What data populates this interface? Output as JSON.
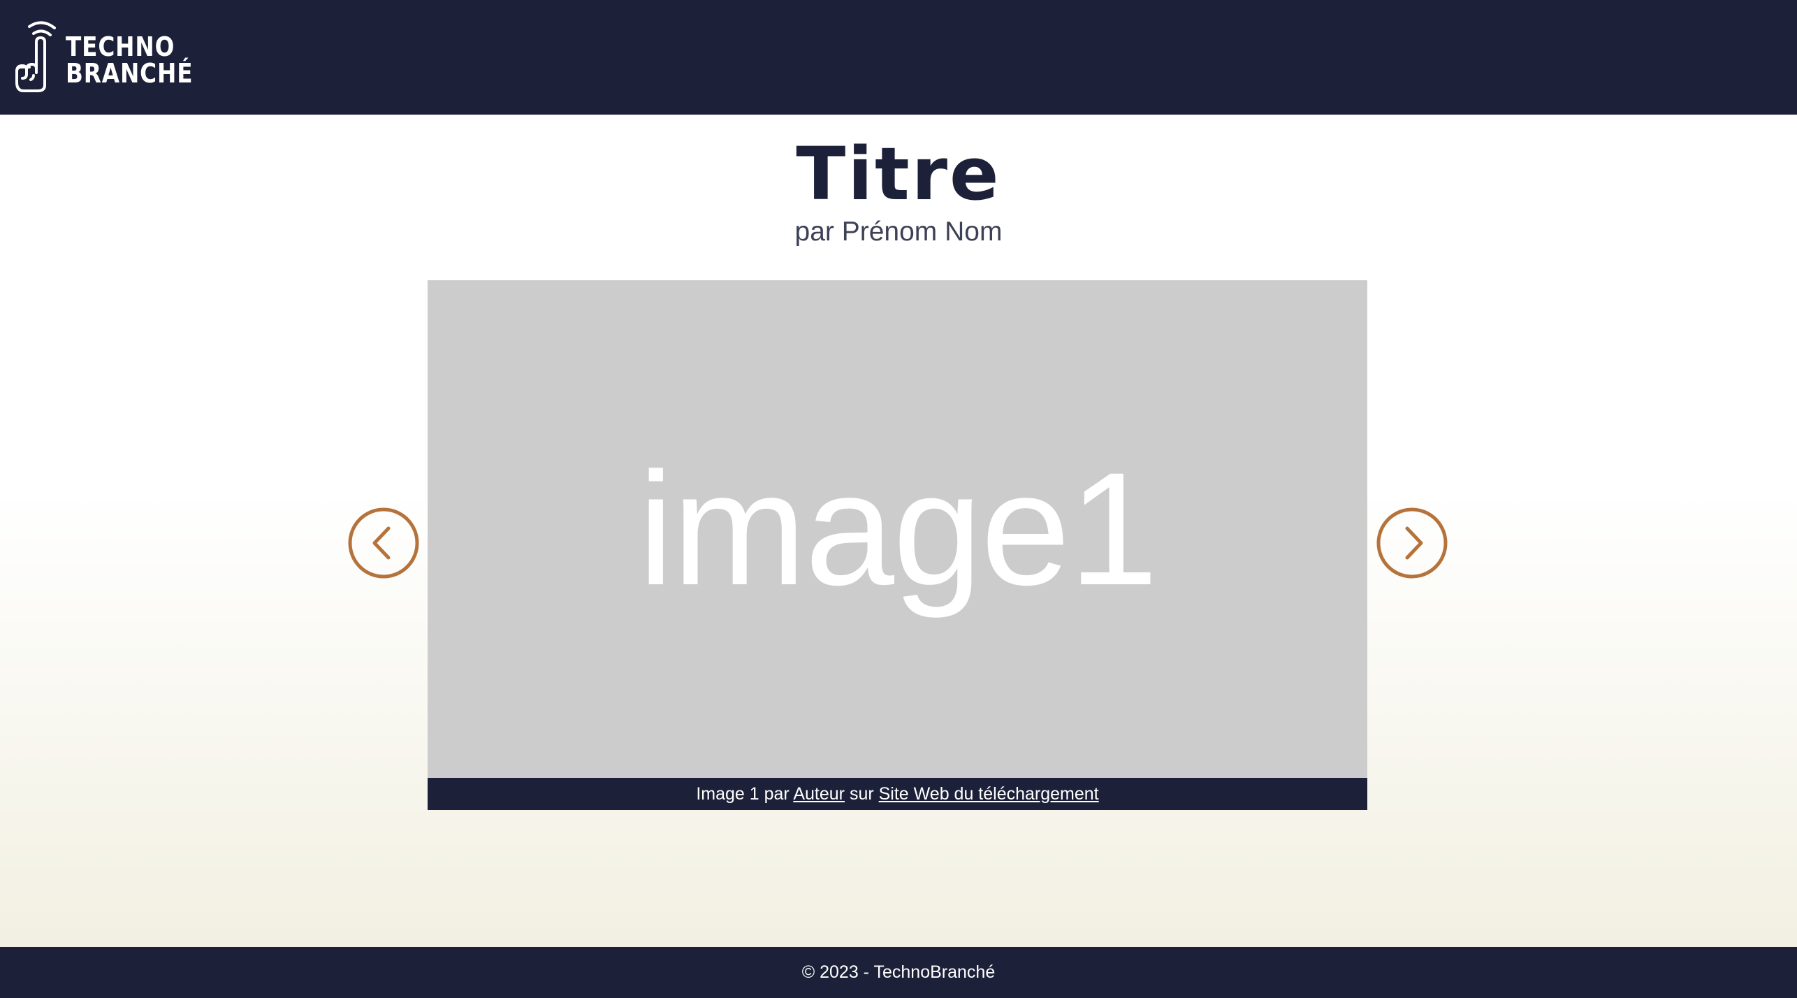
{
  "header": {
    "logo": {
      "icon": "hand-pointing-up-signal-icon",
      "line1": "TECHNO",
      "line2": "BRANCHÉ"
    }
  },
  "main": {
    "title": "Titre",
    "subtitle": "par Prénom Nom"
  },
  "carousel": {
    "prev_icon": "chevron-left-circle-icon",
    "next_icon": "chevron-right-circle-icon",
    "slide_placeholder_text": "image1",
    "caption": {
      "prefix": "Image 1 par ",
      "author_link": "Auteur",
      "middle": " sur ",
      "site_link": "Site Web du téléchargement"
    }
  },
  "footer": {
    "text": "© 2023 - TechnoBranché"
  },
  "colors": {
    "navy": "#1c2039",
    "accent": "#b5733b",
    "placeholder_gray": "#cccccc",
    "cream": "#f2f0e2"
  }
}
